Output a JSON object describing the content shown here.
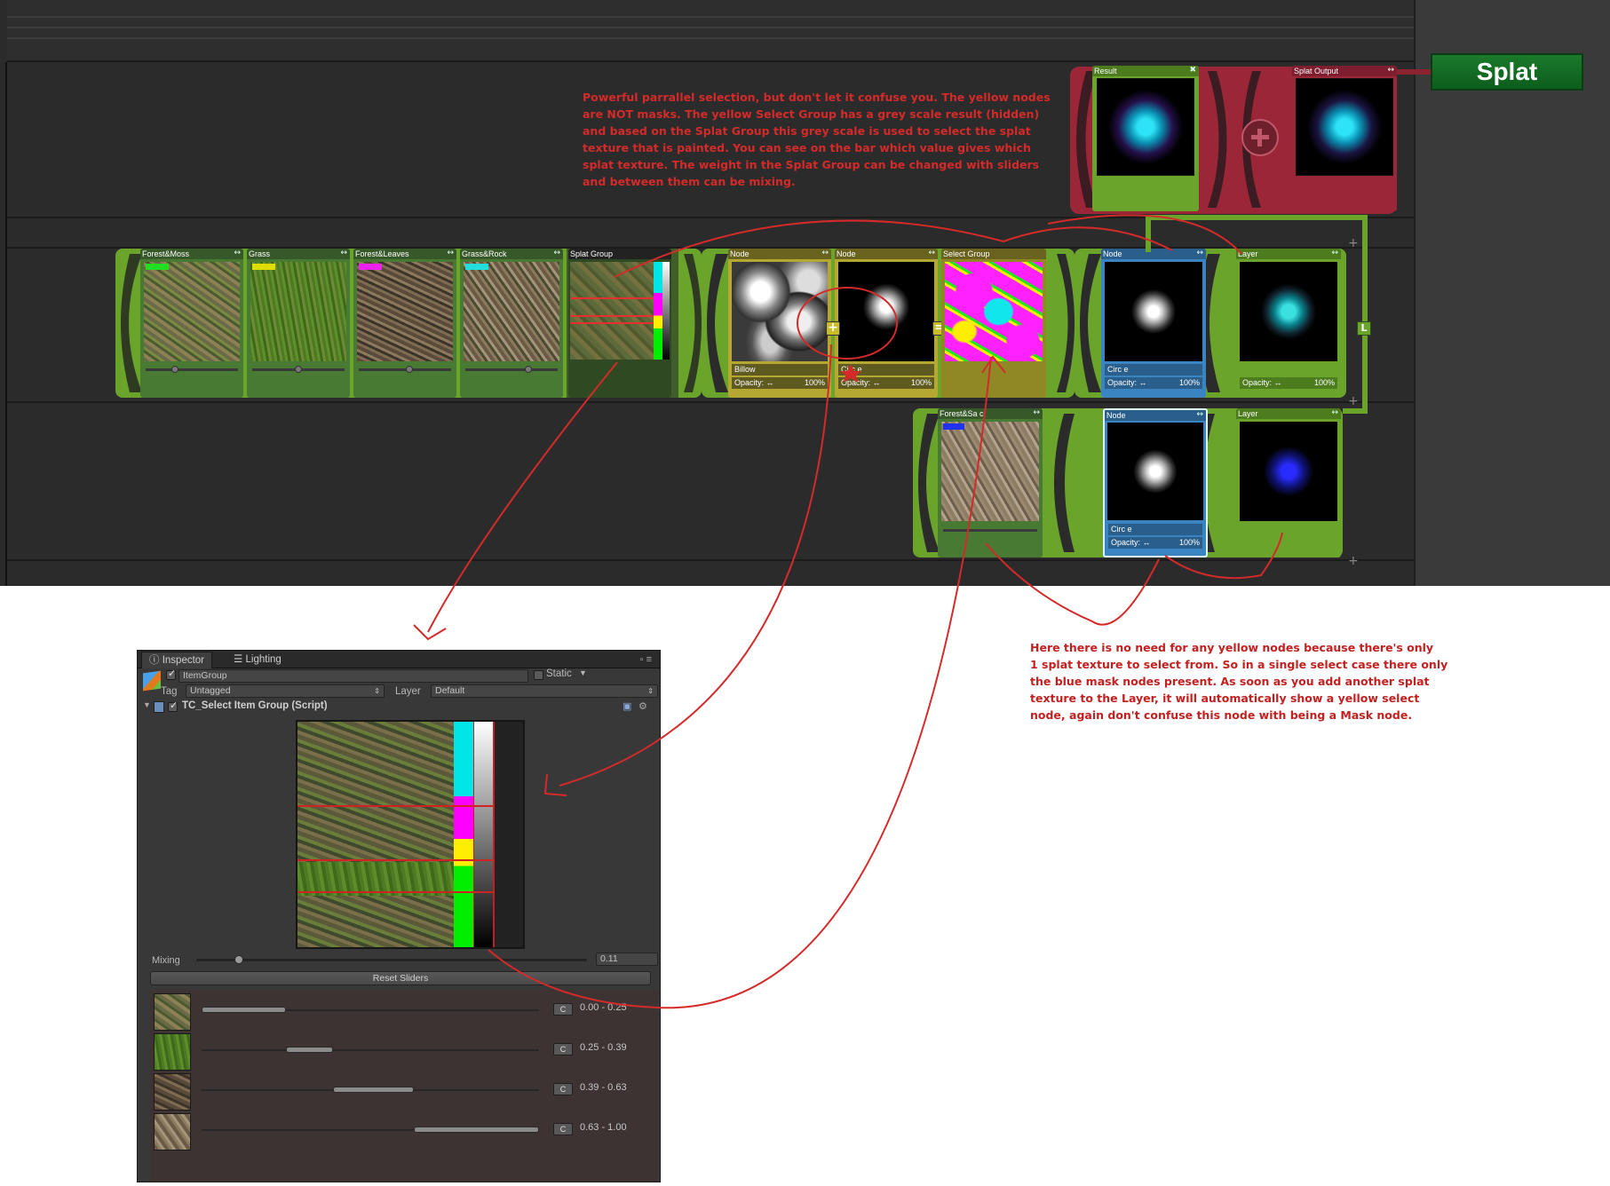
{
  "splat_button": {
    "label": "Splat",
    "color": "#147024"
  },
  "annotation_top": [
    "Powerful parrallel selection, but don't let it confuse you. The yellow nodes",
    "are NOT masks. The yellow Select Group has a grey scale result (hidden)",
    "and based on the Splat Group this grey scale is used to select the splat",
    "texture that is painted. You can see on the bar which value gives which",
    "splat texture. The weight in the Splat Group can be changed with sliders",
    "and between them can be mixing."
  ],
  "annotation_right": [
    "Here there is no need for any yellow nodes because there's only",
    "1 splat texture to select from. So in a single select case there only",
    "the blue mask nodes present. As soon as you add another splat",
    "texture to the Layer, it will automatically show a yellow select",
    "node, again don't confuse this node with being a Mask node."
  ],
  "output_nodes": {
    "result": {
      "title": "Result",
      "icon": "x-icon"
    },
    "splat_output": {
      "title": "Splat Output",
      "arrows": "<>",
      "icon": "x-icon"
    },
    "add_icon": "plus-icon"
  },
  "splat_group_row": {
    "items": [
      {
        "title": "Forest&Moss",
        "swatch": "#22dd22",
        "arrows": "<>"
      },
      {
        "title": "Grass",
        "swatch": "#dddd00",
        "arrows": "<>"
      },
      {
        "title": "Forest&Leaves",
        "swatch": "#ee22ee",
        "arrows": "<>"
      },
      {
        "title": "Grass&Rock",
        "swatch": "#22dddd",
        "arrows": "<>"
      }
    ],
    "group_title": "Splat Group"
  },
  "select_row": {
    "node1": {
      "title": "Node",
      "sub": "Billow",
      "opacity_label": "Opacity:",
      "opacity_value": "100%",
      "arrows": "<>"
    },
    "node2": {
      "title": "Node",
      "sub": "Circ e",
      "opacity_label": "Opacity:",
      "opacity_value": "100%",
      "arrows": "<>"
    },
    "select_group": {
      "title": "Select Group"
    },
    "node3": {
      "title": "Node",
      "sub": "Circ e",
      "opacity_label": "Opacity:",
      "opacity_value": "100%",
      "arrows": "<>"
    },
    "layer": {
      "title": "Layer",
      "opacity_label": "Opacity:",
      "opacity_value": "100%",
      "arrows": "<>"
    },
    "plus_glyph": "+",
    "equals_glyph": "=",
    "l_badge": "L"
  },
  "sand_row": {
    "forest_sand": {
      "title": "Forest&Sa c",
      "swatch": "#2233ee",
      "arrows": "<>"
    },
    "node": {
      "title": "Node",
      "sub": "Circ e",
      "opacity_label": "Opacity:",
      "opacity_value": "100%",
      "arrows": "<>"
    },
    "layer": {
      "title": "Layer",
      "arrows": "<>"
    }
  },
  "inspector": {
    "tabs": [
      {
        "label": "Inspector",
        "icon": "info-icon"
      },
      {
        "label": "Lighting",
        "icon": "lighting-icon"
      }
    ],
    "object_name": "ItemGroup",
    "static_label": "Static",
    "tag_label": "Tag",
    "tag_value": "Untagged",
    "layer_label": "Layer",
    "layer_value": "Default",
    "script_title": "TC_Select Item Group (Script)",
    "mixing_label": "Mixing",
    "mixing_value": "0.11",
    "mixing_level": 0.11,
    "reset_label": "Reset Sliders",
    "slider_rows": [
      {
        "c_label": "C",
        "range_text": "0.00 - 0.25",
        "min": 0.0,
        "max": 0.25
      },
      {
        "c_label": "C",
        "range_text": "0.25 - 0.39",
        "min": 0.25,
        "max": 0.39
      },
      {
        "c_label": "C",
        "range_text": "0.39 - 0.63",
        "min": 0.39,
        "max": 0.63
      },
      {
        "c_label": "C",
        "range_text": "0.63 - 1.00",
        "min": 0.63,
        "max": 1.0
      }
    ]
  },
  "colors": {
    "accent_red": "#d42a2a",
    "node_green": "#6aa42b",
    "node_yellow": "#c9bd2a",
    "node_blue": "#3b84c2",
    "output_red": "#a8283c"
  }
}
